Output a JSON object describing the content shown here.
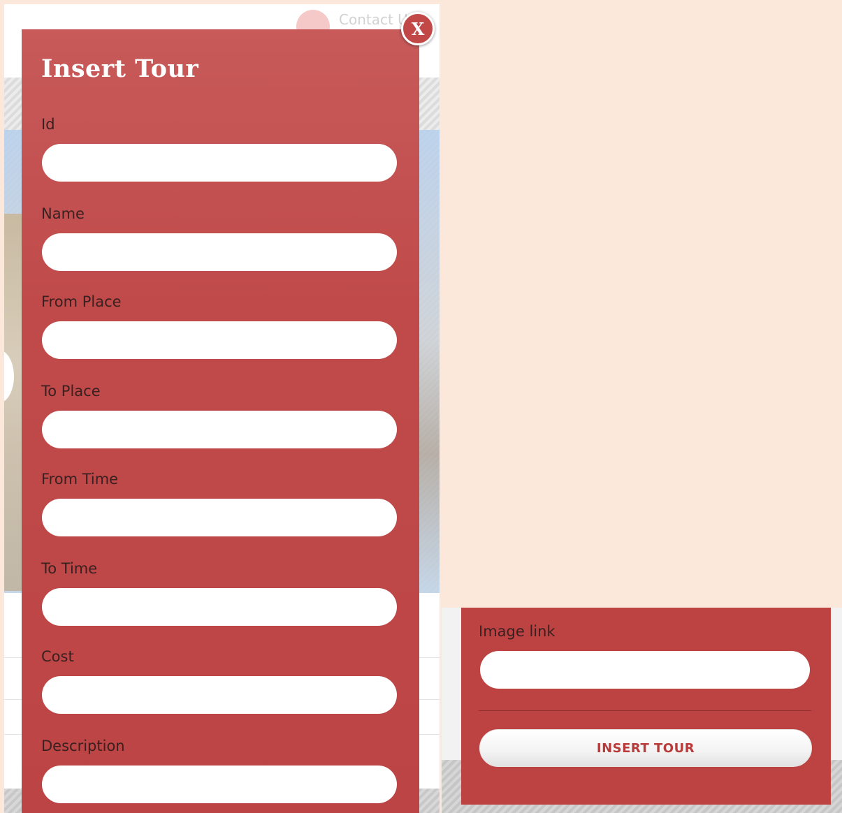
{
  "background": {
    "contact_link": "Contact U"
  },
  "modal": {
    "title": "Insert Tour",
    "close_label": "X",
    "fields": [
      {
        "label": "Id",
        "value": ""
      },
      {
        "label": "Name",
        "value": ""
      },
      {
        "label": "From Place",
        "value": ""
      },
      {
        "label": "To Place",
        "value": ""
      },
      {
        "label": "From Time",
        "value": ""
      },
      {
        "label": "To Time",
        "value": ""
      },
      {
        "label": "Cost",
        "value": ""
      },
      {
        "label": "Description",
        "value": ""
      }
    ],
    "image_link": {
      "label": "Image link",
      "value": ""
    },
    "submit_label": "INSERT TOUR"
  },
  "colors": {
    "modal": "#bd4444",
    "page_background": "#fbe8da",
    "button_text": "#b83a3a"
  }
}
